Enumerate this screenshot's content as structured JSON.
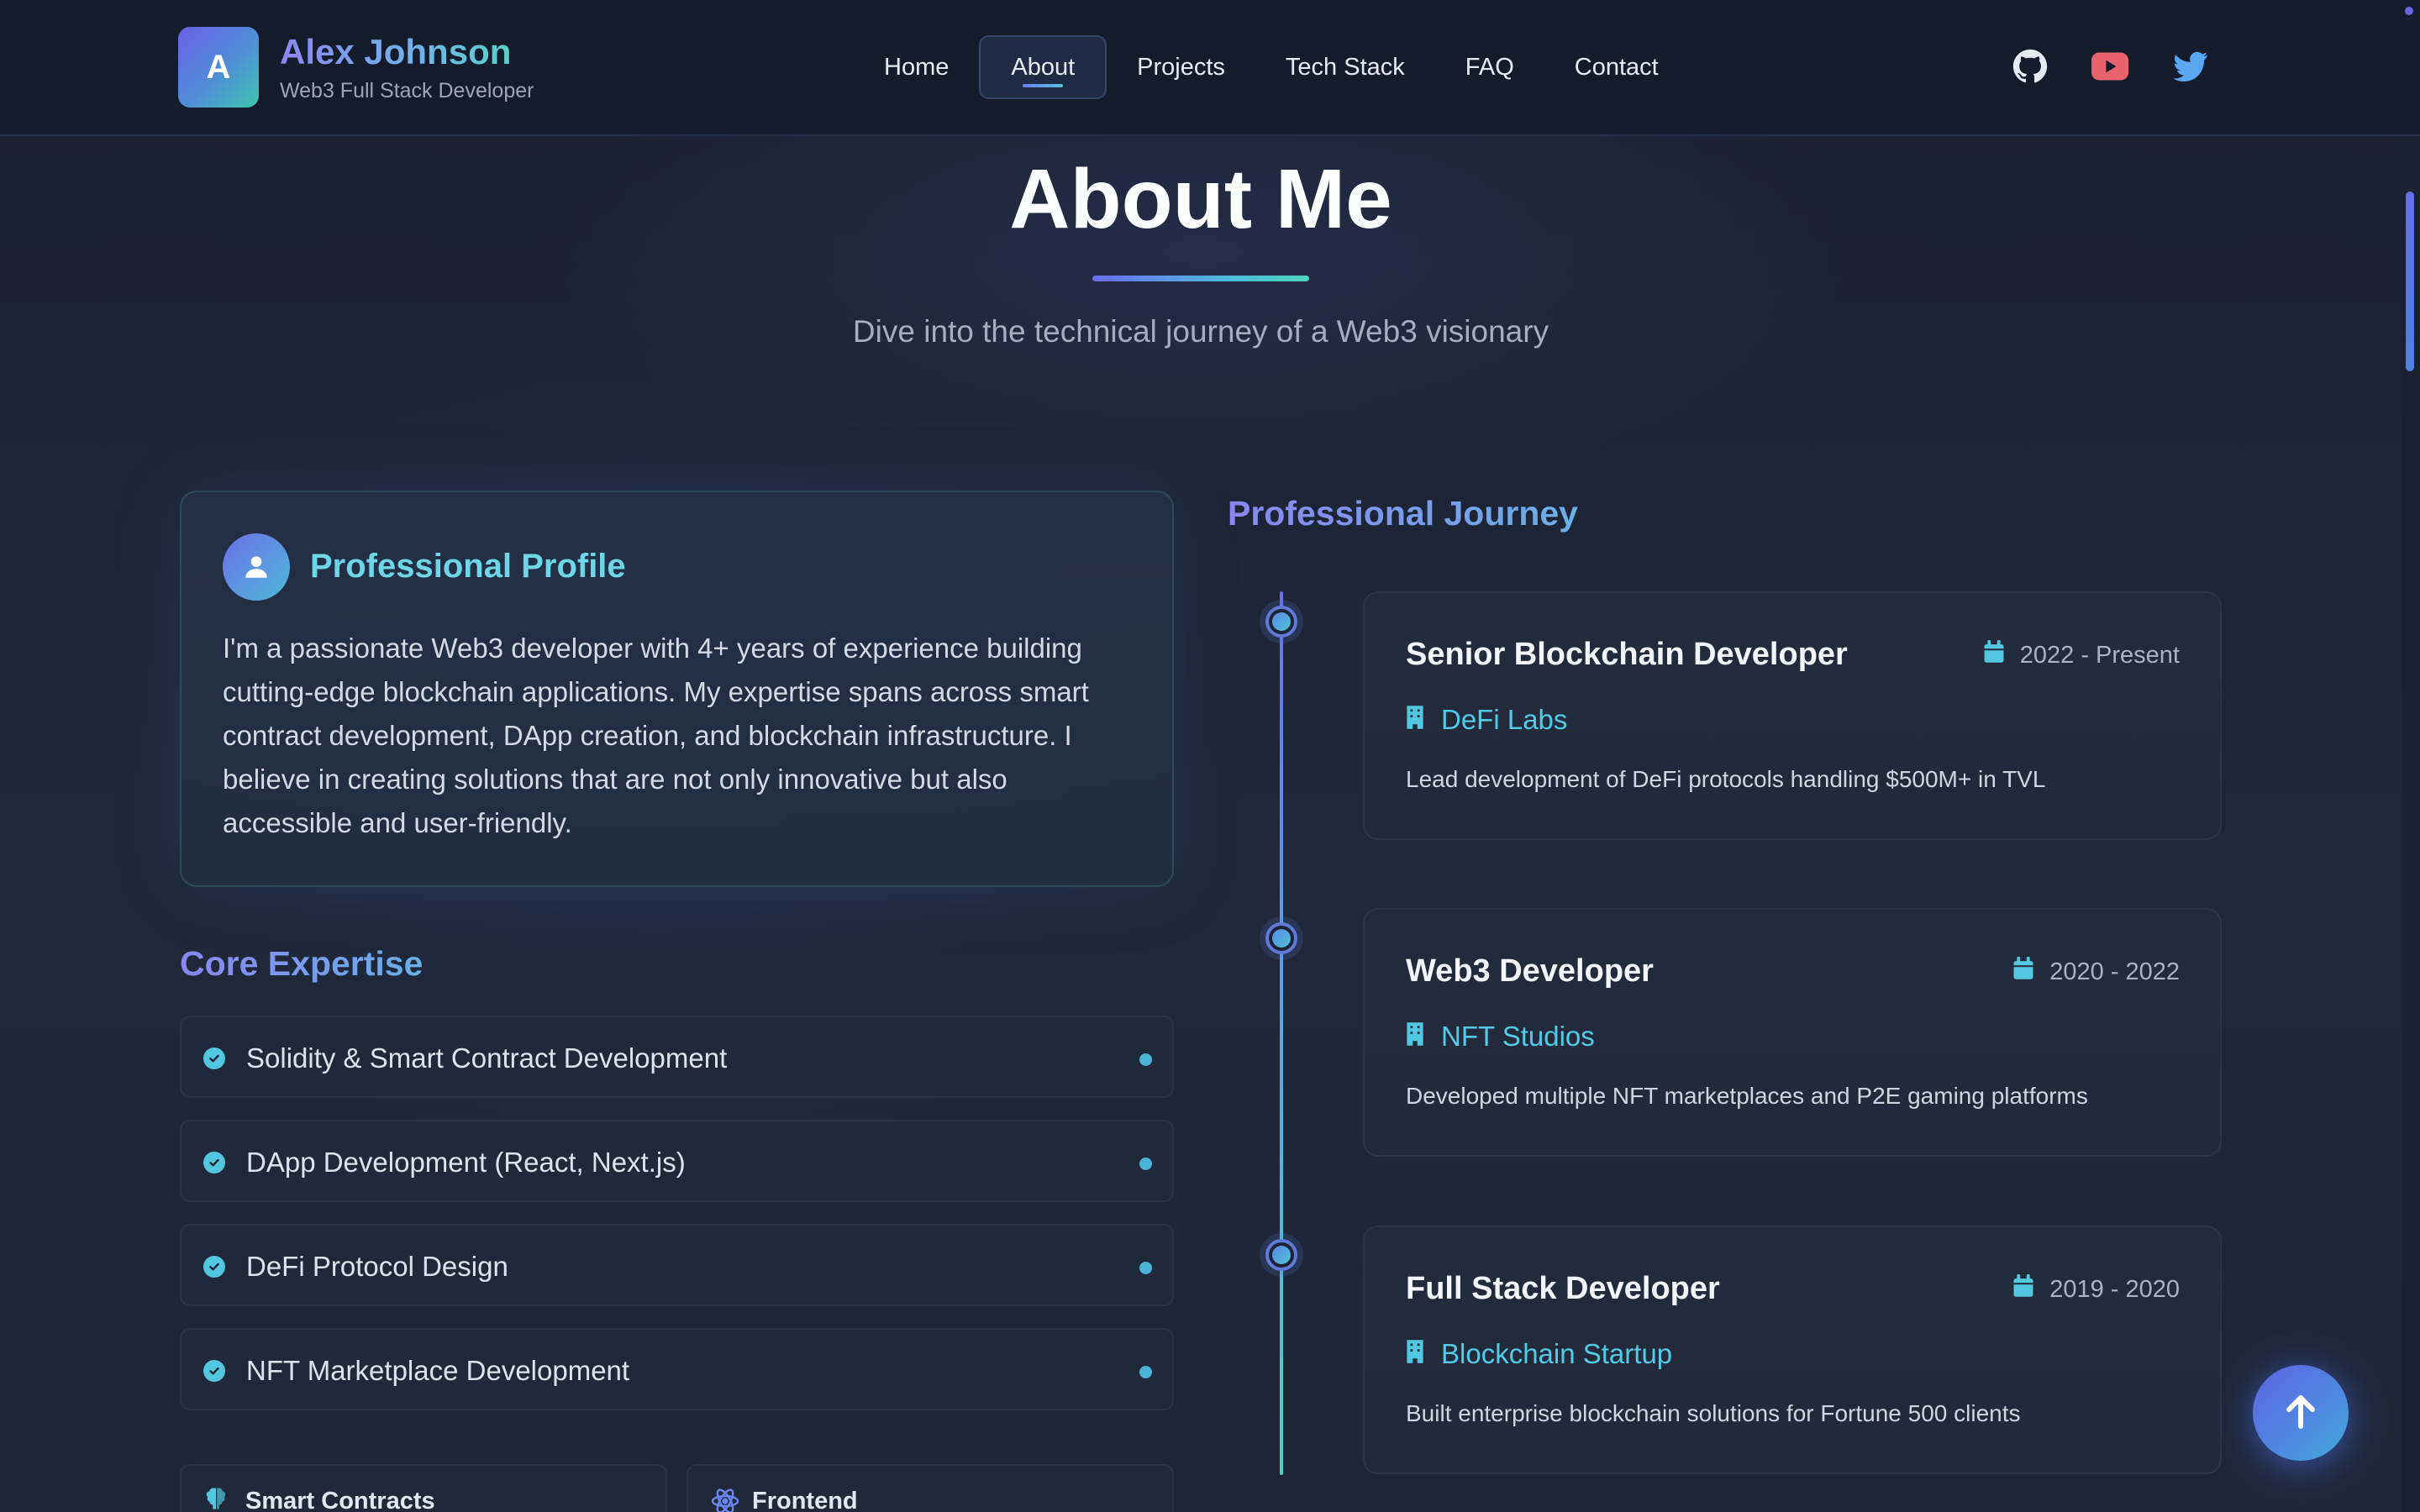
{
  "brand": {
    "logo_letter": "A",
    "name": "Alex Johnson",
    "subtitle": "Web3 Full Stack Developer"
  },
  "nav": {
    "items": [
      {
        "label": "Home"
      },
      {
        "label": "About"
      },
      {
        "label": "Projects"
      },
      {
        "label": "Tech Stack"
      },
      {
        "label": "FAQ"
      },
      {
        "label": "Contact"
      }
    ],
    "active": "About"
  },
  "social": {
    "icons": [
      "github-icon",
      "youtube-icon",
      "twitter-icon"
    ],
    "colors": {
      "github": "#e6ebf2",
      "youtube": "#e8636b",
      "twitter": "#5aa6f0"
    }
  },
  "hero": {
    "title": "About Me",
    "subtitle": "Dive into the technical journey of a Web3 visionary"
  },
  "profile": {
    "icon": "user-icon",
    "title": "Professional Profile",
    "text": "I'm a passionate Web3 developer with 4+ years of experience building cutting-edge blockchain applications. My expertise spans across smart contract development, DApp creation, and blockchain infrastructure. I believe in creating solutions that are not only innovative but also accessible and user-friendly."
  },
  "expertise": {
    "heading": "Core Expertise",
    "items": [
      {
        "label": "Solidity & Smart Contract Development"
      },
      {
        "label": "DApp Development (React, Next.js)"
      },
      {
        "label": "DeFi Protocol Design"
      },
      {
        "label": "NFT Marketplace Development"
      }
    ],
    "categories": [
      {
        "label": "Smart Contracts",
        "icon": "brain-icon"
      },
      {
        "label": "Frontend",
        "icon": "atom-icon"
      }
    ]
  },
  "journey": {
    "heading": "Professional Journey",
    "jobs": [
      {
        "title": "Senior Blockchain Developer",
        "date": "2022 - Present",
        "company": "DeFi Labs",
        "description": "Lead development of DeFi protocols handling $500M+ in TVL"
      },
      {
        "title": "Web3 Developer",
        "date": "2020 - 2022",
        "company": "NFT Studios",
        "description": "Developed multiple NFT marketplaces and P2E gaming platforms"
      },
      {
        "title": "Full Stack Developer",
        "date": "2019 - 2020",
        "company": "Blockchain Startup",
        "description": "Built enterprise blockchain solutions for Fortune 500 clients"
      }
    ]
  },
  "theme": {
    "accent_cyan": "#54cbe6",
    "accent_indigo": "#7f8ef0",
    "background": "#1b2233"
  }
}
